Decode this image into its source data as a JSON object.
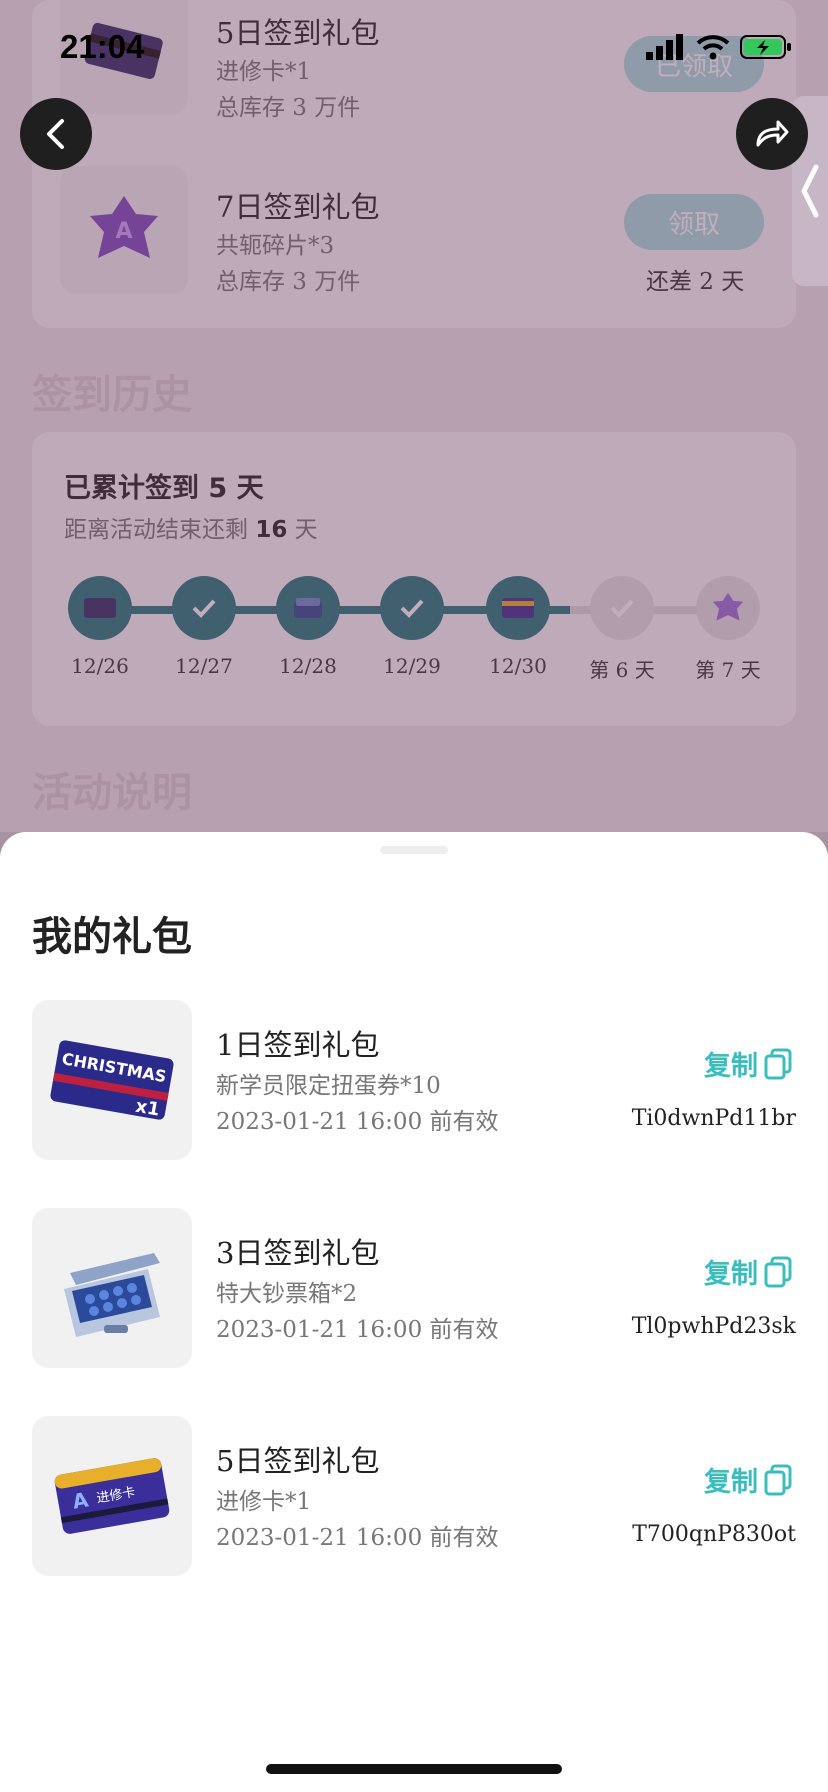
{
  "status_bar": {
    "time": "21:04"
  },
  "bg": {
    "rows": [
      {
        "title": "5日签到礼包",
        "item": "进修卡*1",
        "stock": "总库存 3 万件",
        "button": "已领取"
      },
      {
        "title": "7日签到礼包",
        "item": "共轭碎片*3",
        "stock": "总库存 3 万件",
        "button": "领取",
        "note": "还差 2 天"
      }
    ],
    "history_title": "签到历史",
    "summary_prefix": "已累计签到",
    "summary_days": "5",
    "summary_suffix": "天",
    "remaining_prefix": "距离活动结束还剩",
    "remaining_days": "16",
    "remaining_suffix": "天",
    "timeline": [
      "12/26",
      "12/27",
      "12/28",
      "12/29",
      "12/30",
      "第 6 天",
      "第 7 天"
    ],
    "rules_title": "活动说明"
  },
  "sheet": {
    "title": "我的礼包",
    "copy_label": "复制",
    "gifts": [
      {
        "title": "1日签到礼包",
        "item": "新学员限定扭蛋券*10",
        "expiry": "2023-01-21 16:00 前有效",
        "code": "Ti0dwnPd11br"
      },
      {
        "title": "3日签到礼包",
        "item": "特大钞票箱*2",
        "expiry": "2023-01-21 16:00 前有效",
        "code": "Tl0pwhPd23sk"
      },
      {
        "title": "5日签到礼包",
        "item": "进修卡*1",
        "expiry": "2023-01-21 16:00 前有效",
        "code": "T700qnP830ot"
      }
    ],
    "thumb_text": {
      "christmas": "CHRISTMAS",
      "christmas_qty": "x1",
      "card": "进修卡"
    }
  },
  "colors": {
    "accent": "#3cbdbd",
    "timeline_active": "#1f7a7a",
    "overlay": "#6e3c5f"
  },
  "icons": {
    "back": "chevron-left-icon",
    "share": "share-icon",
    "copy": "copy-icon",
    "check": "check-icon"
  }
}
